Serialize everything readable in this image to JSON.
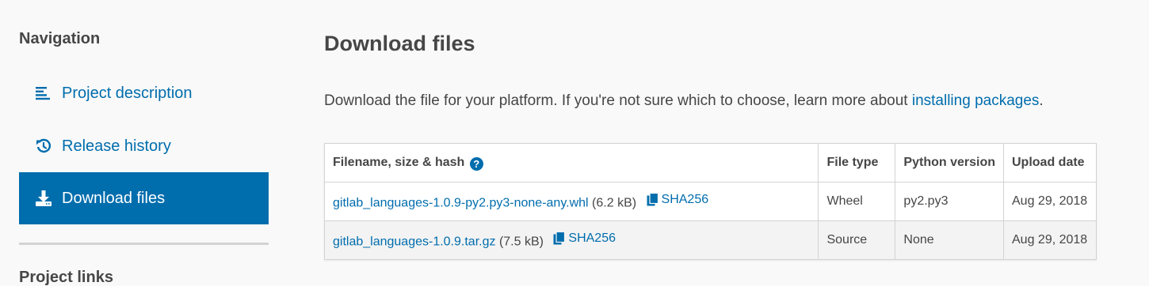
{
  "sidebar": {
    "heading": "Navigation",
    "items": [
      {
        "label": "Project description",
        "icon": "align-left-icon"
      },
      {
        "label": "Release history",
        "icon": "history-icon"
      },
      {
        "label": "Download files",
        "icon": "download-icon",
        "active": true
      }
    ],
    "links_heading": "Project links"
  },
  "main": {
    "title": "Download files",
    "intro_text": "Download the file for your platform. If you're not sure which to choose, learn more about ",
    "intro_link": "installing packages",
    "intro_suffix": ".",
    "table": {
      "headers": {
        "filename": "Filename, size & hash",
        "file_type": "File type",
        "python_version": "Python version",
        "upload_date": "Upload date"
      },
      "rows": [
        {
          "filename": "gitlab_languages-1.0.9-py2.py3-none-any.whl",
          "size": "(6.2 kB)",
          "hash": "SHA256",
          "file_type": "Wheel",
          "python_version": "py2.py3",
          "upload_date": "Aug 29, 2018"
        },
        {
          "filename": "gitlab_languages-1.0.9.tar.gz",
          "size": "(7.5 kB)",
          "hash": "SHA256",
          "file_type": "Source",
          "python_version": "None",
          "upload_date": "Aug 29, 2018"
        }
      ]
    }
  },
  "colors": {
    "accent": "#006dad",
    "text": "#464646",
    "background": "#f9f9f9"
  }
}
